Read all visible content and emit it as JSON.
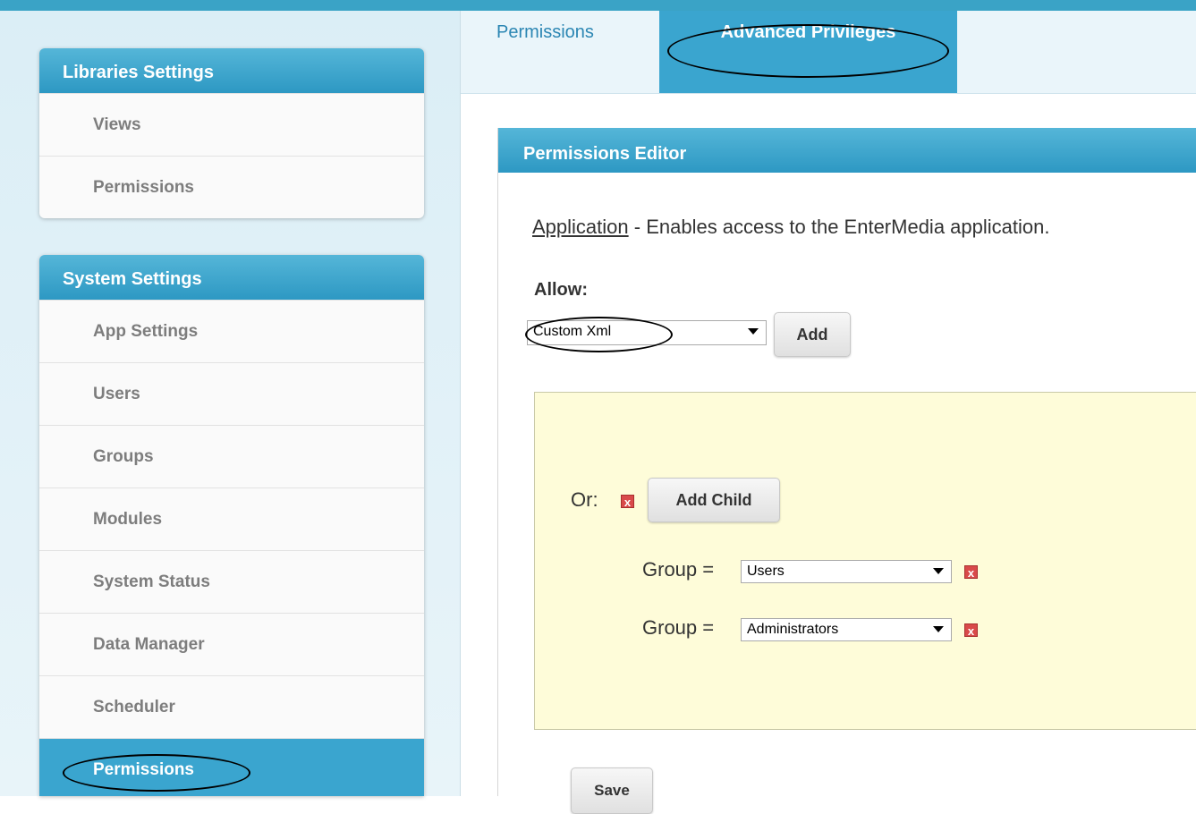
{
  "libraries_panel": {
    "title": "Libraries Settings",
    "items": [
      {
        "label": "Views"
      },
      {
        "label": "Permissions"
      }
    ]
  },
  "system_panel": {
    "title": "System Settings",
    "items": [
      {
        "label": "App Settings"
      },
      {
        "label": "Users"
      },
      {
        "label": "Groups"
      },
      {
        "label": "Modules"
      },
      {
        "label": "System Status"
      },
      {
        "label": "Data Manager"
      },
      {
        "label": "Scheduler"
      },
      {
        "label": "Permissions"
      }
    ],
    "active_index": 7
  },
  "tabs": [
    {
      "label": "Permissions"
    },
    {
      "label": "Advanced Privileges",
      "active": true
    }
  ],
  "editor": {
    "title": "Permissions Editor",
    "app_link": "Application",
    "app_description": " - Enables access to the EnterMedia application.",
    "allow_label": "Allow:",
    "allow_select_value": "Custom Xml",
    "add_label": "Add",
    "or_label": "Or:",
    "add_child_label": "Add Child",
    "conditions": [
      {
        "label": "Group =",
        "value": "Users"
      },
      {
        "label": "Group =",
        "value": "Administrators"
      }
    ],
    "remove_icon": "x",
    "save_label": "Save"
  },
  "colors": {
    "accent": "#3aa5cf",
    "remove": "#d94a4a",
    "rule_bg": "#fefcd9"
  }
}
